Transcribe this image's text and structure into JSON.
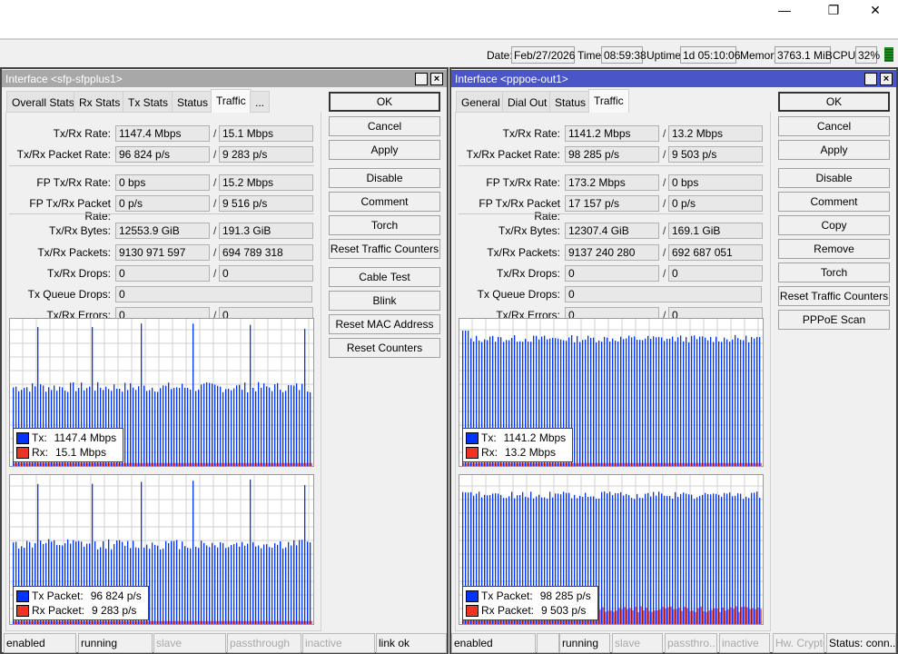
{
  "window_controls": {
    "minimize": "—",
    "maximize": "❐",
    "close": "✕"
  },
  "infobar": {
    "date_label": "Date:",
    "date": "Feb/27/2026",
    "time_label": "Time:",
    "time": "08:59:38",
    "uptime_label": "Uptime:",
    "uptime": "1d 05:10:06",
    "memory_label": "Memory:",
    "memory": "3763.1 MiB",
    "cpu_label": "CPU:",
    "cpu": "32%",
    "cpu_fraction": 0.32
  },
  "colors": {
    "tx": "#0033ff",
    "rx": "#ee3322",
    "active_title": "#4a55c8",
    "inactive_title": "#a8a8a8"
  },
  "left": {
    "title": "Interface <sfp-sfpplus1>",
    "tabs": [
      "Overall Stats",
      "Rx Stats",
      "Tx Stats",
      "Status",
      "Traffic",
      "..."
    ],
    "active_tab": "Traffic",
    "rows": [
      {
        "label": "Tx/Rx Rate:",
        "v1": "1147.4 Mbps",
        "v2": "15.1 Mbps"
      },
      {
        "label": "Tx/Rx Packet Rate:",
        "v1": "96 824 p/s",
        "v2": "9 283 p/s"
      },
      {
        "label": "FP Tx/Rx Rate:",
        "v1": "0 bps",
        "v2": "15.2 Mbps"
      },
      {
        "label": "FP Tx/Rx Packet Rate:",
        "v1": "0 p/s",
        "v2": "9 516 p/s"
      },
      {
        "label": "Tx/Rx Bytes:",
        "v1": "12553.9 GiB",
        "v2": "191.3 GiB"
      },
      {
        "label": "Tx/Rx Packets:",
        "v1": "9130 971 597",
        "v2": "694 789 318"
      },
      {
        "label": "Tx/Rx Drops:",
        "v1": "0",
        "v2": "0"
      },
      {
        "label": "Tx Queue Drops:",
        "v1": "0"
      },
      {
        "label": "Tx/Rx Errors:",
        "v1": "0",
        "v2": "0"
      }
    ],
    "graph1": {
      "tx_label": "Tx:",
      "tx": "1147.4 Mbps",
      "rx_label": "Rx:",
      "rx": "15.1 Mbps"
    },
    "graph2": {
      "tx_label": "Tx Packet:",
      "tx": "96 824 p/s",
      "rx_label": "Rx Packet:",
      "rx": "9 283 p/s"
    },
    "buttons": [
      "OK",
      "Cancel",
      "Apply",
      "Disable",
      "Comment",
      "Torch",
      "Reset Traffic Counters",
      "Cable Test",
      "Blink",
      "Reset MAC Address",
      "Reset Counters"
    ],
    "status": [
      "enabled",
      "running",
      "slave",
      "passthrough",
      "inactive",
      "link ok"
    ]
  },
  "right": {
    "title": "Interface <pppoe-out1>",
    "tabs": [
      "General",
      "Dial Out",
      "Status",
      "Traffic"
    ],
    "active_tab": "Traffic",
    "rows": [
      {
        "label": "Tx/Rx Rate:",
        "v1": "1141.2 Mbps",
        "v2": "13.2 Mbps"
      },
      {
        "label": "Tx/Rx Packet Rate:",
        "v1": "98 285 p/s",
        "v2": "9 503 p/s"
      },
      {
        "label": "FP Tx/Rx Rate:",
        "v1": "173.2 Mbps",
        "v2": "0 bps"
      },
      {
        "label": "FP Tx/Rx Packet Rate:",
        "v1": "17 157 p/s",
        "v2": "0 p/s"
      },
      {
        "label": "Tx/Rx Bytes:",
        "v1": "12307.4 GiB",
        "v2": "169.1 GiB"
      },
      {
        "label": "Tx/Rx Packets:",
        "v1": "9137 240 280",
        "v2": "692 687 051"
      },
      {
        "label": "Tx/Rx Drops:",
        "v1": "0",
        "v2": "0"
      },
      {
        "label": "Tx Queue Drops:",
        "v1": "0"
      },
      {
        "label": "Tx/Rx Errors:",
        "v1": "0",
        "v2": "0"
      }
    ],
    "graph1": {
      "tx_label": "Tx:",
      "tx": "1141.2 Mbps",
      "rx_label": "Rx:",
      "rx": "13.2 Mbps"
    },
    "graph2": {
      "tx_label": "Tx Packet:",
      "tx": "98 285 p/s",
      "rx_label": "Rx Packet:",
      "rx": "9 503 p/s"
    },
    "buttons": [
      "OK",
      "Cancel",
      "Apply",
      "Disable",
      "Comment",
      "Copy",
      "Remove",
      "Torch",
      "Reset Traffic Counters",
      "PPPoE Scan"
    ],
    "status": [
      "enabled",
      "",
      "running",
      "slave",
      "passthro...",
      "inactive",
      "Hw. Crypto",
      "Status: conn..."
    ]
  }
}
